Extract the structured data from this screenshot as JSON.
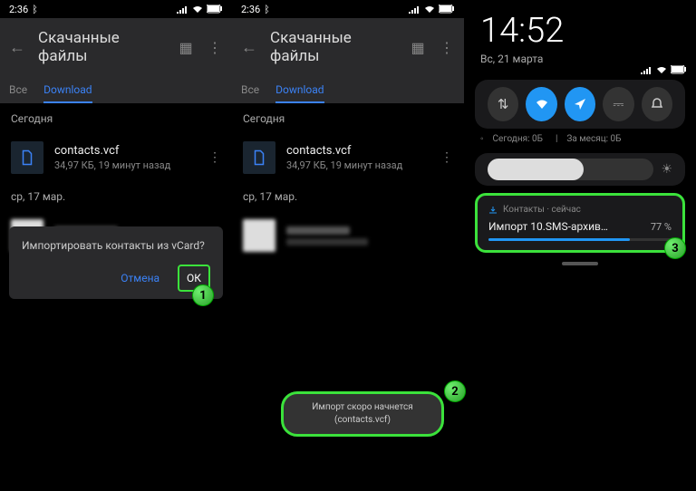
{
  "statusbar": {
    "time1": "2:36",
    "time2": "2:36",
    "bt": "⁂"
  },
  "header": {
    "title": "Скачанные файлы"
  },
  "tabs": {
    "all": "Все",
    "download": "Download"
  },
  "sections": {
    "today": "Сегодня",
    "mar17": "ср, 17 мар."
  },
  "file": {
    "name": "contacts.vcf",
    "meta": "34,97 КБ, 19 минут назад"
  },
  "dialog": {
    "text": "Импортировать контакты из vCard?",
    "cancel": "Отмена",
    "ok": "ОК"
  },
  "toast": {
    "line1": "Импорт скоро начнется",
    "line2": "(contacts.vcf)"
  },
  "panel3": {
    "clock": "14:52",
    "date": "Вс, 21 марта",
    "usage_today": "Сегодня: 0Б",
    "usage_month": "За месяц: 0Б",
    "notif_app": "Контакты · сейчас",
    "notif_title": "Импорт 10.SMS-архив…",
    "notif_pct": "77 %"
  },
  "badges": {
    "b1": "1",
    "b2": "2",
    "b3": "3"
  }
}
